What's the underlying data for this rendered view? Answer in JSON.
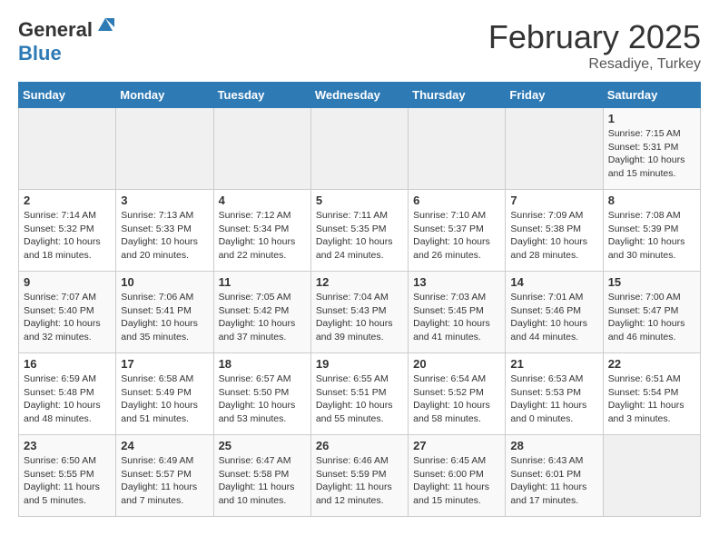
{
  "header": {
    "logo_general": "General",
    "logo_blue": "Blue",
    "month_year": "February 2025",
    "location": "Resadiye, Turkey"
  },
  "days_of_week": [
    "Sunday",
    "Monday",
    "Tuesday",
    "Wednesday",
    "Thursday",
    "Friday",
    "Saturday"
  ],
  "weeks": [
    [
      {
        "day": "",
        "empty": true
      },
      {
        "day": "",
        "empty": true
      },
      {
        "day": "",
        "empty": true
      },
      {
        "day": "",
        "empty": true
      },
      {
        "day": "",
        "empty": true
      },
      {
        "day": "",
        "empty": true
      },
      {
        "day": "1",
        "rise": "7:15 AM",
        "set": "5:31 PM",
        "daylight": "10 hours and 15 minutes."
      }
    ],
    [
      {
        "day": "2",
        "rise": "7:14 AM",
        "set": "5:32 PM",
        "daylight": "10 hours and 18 minutes."
      },
      {
        "day": "3",
        "rise": "7:13 AM",
        "set": "5:33 PM",
        "daylight": "10 hours and 20 minutes."
      },
      {
        "day": "4",
        "rise": "7:12 AM",
        "set": "5:34 PM",
        "daylight": "10 hours and 22 minutes."
      },
      {
        "day": "5",
        "rise": "7:11 AM",
        "set": "5:35 PM",
        "daylight": "10 hours and 24 minutes."
      },
      {
        "day": "6",
        "rise": "7:10 AM",
        "set": "5:37 PM",
        "daylight": "10 hours and 26 minutes."
      },
      {
        "day": "7",
        "rise": "7:09 AM",
        "set": "5:38 PM",
        "daylight": "10 hours and 28 minutes."
      },
      {
        "day": "8",
        "rise": "7:08 AM",
        "set": "5:39 PM",
        "daylight": "10 hours and 30 minutes."
      }
    ],
    [
      {
        "day": "9",
        "rise": "7:07 AM",
        "set": "5:40 PM",
        "daylight": "10 hours and 32 minutes."
      },
      {
        "day": "10",
        "rise": "7:06 AM",
        "set": "5:41 PM",
        "daylight": "10 hours and 35 minutes."
      },
      {
        "day": "11",
        "rise": "7:05 AM",
        "set": "5:42 PM",
        "daylight": "10 hours and 37 minutes."
      },
      {
        "day": "12",
        "rise": "7:04 AM",
        "set": "5:43 PM",
        "daylight": "10 hours and 39 minutes."
      },
      {
        "day": "13",
        "rise": "7:03 AM",
        "set": "5:45 PM",
        "daylight": "10 hours and 41 minutes."
      },
      {
        "day": "14",
        "rise": "7:01 AM",
        "set": "5:46 PM",
        "daylight": "10 hours and 44 minutes."
      },
      {
        "day": "15",
        "rise": "7:00 AM",
        "set": "5:47 PM",
        "daylight": "10 hours and 46 minutes."
      }
    ],
    [
      {
        "day": "16",
        "rise": "6:59 AM",
        "set": "5:48 PM",
        "daylight": "10 hours and 48 minutes."
      },
      {
        "day": "17",
        "rise": "6:58 AM",
        "set": "5:49 PM",
        "daylight": "10 hours and 51 minutes."
      },
      {
        "day": "18",
        "rise": "6:57 AM",
        "set": "5:50 PM",
        "daylight": "10 hours and 53 minutes."
      },
      {
        "day": "19",
        "rise": "6:55 AM",
        "set": "5:51 PM",
        "daylight": "10 hours and 55 minutes."
      },
      {
        "day": "20",
        "rise": "6:54 AM",
        "set": "5:52 PM",
        "daylight": "10 hours and 58 minutes."
      },
      {
        "day": "21",
        "rise": "6:53 AM",
        "set": "5:53 PM",
        "daylight": "11 hours and 0 minutes."
      },
      {
        "day": "22",
        "rise": "6:51 AM",
        "set": "5:54 PM",
        "daylight": "11 hours and 3 minutes."
      }
    ],
    [
      {
        "day": "23",
        "rise": "6:50 AM",
        "set": "5:55 PM",
        "daylight": "11 hours and 5 minutes."
      },
      {
        "day": "24",
        "rise": "6:49 AM",
        "set": "5:57 PM",
        "daylight": "11 hours and 7 minutes."
      },
      {
        "day": "25",
        "rise": "6:47 AM",
        "set": "5:58 PM",
        "daylight": "11 hours and 10 minutes."
      },
      {
        "day": "26",
        "rise": "6:46 AM",
        "set": "5:59 PM",
        "daylight": "11 hours and 12 minutes."
      },
      {
        "day": "27",
        "rise": "6:45 AM",
        "set": "6:00 PM",
        "daylight": "11 hours and 15 minutes."
      },
      {
        "day": "28",
        "rise": "6:43 AM",
        "set": "6:01 PM",
        "daylight": "11 hours and 17 minutes."
      },
      {
        "day": "",
        "empty": true
      }
    ]
  ]
}
